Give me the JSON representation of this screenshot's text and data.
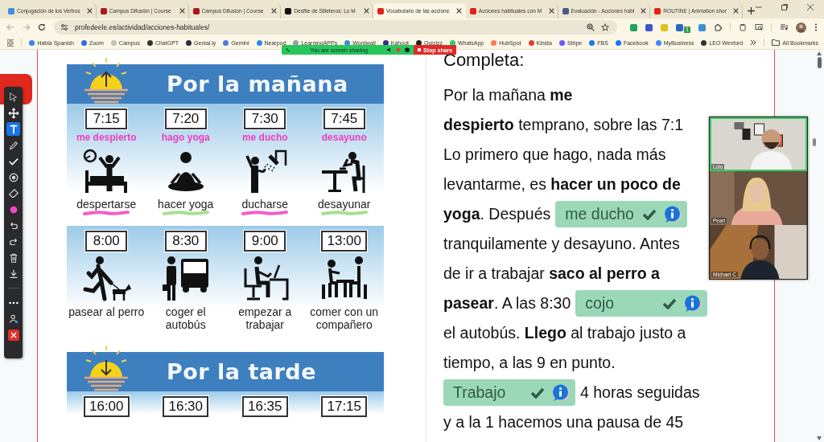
{
  "browser": {
    "tabs": [
      {
        "title": "Conjugación de los Verbos",
        "color": "#3d8fe0",
        "selected": false
      },
      {
        "title": "Campus Difusión | Course",
        "color": "#b01818",
        "selected": false
      },
      {
        "title": "Campus Difusión | Course",
        "color": "#b01818",
        "selected": false
      },
      {
        "title": "Desfile de Silleteros: Lo M",
        "color": "#111111",
        "selected": false
      },
      {
        "title": "Vocabulario de las accione",
        "color": "#e02020",
        "selected": true
      },
      {
        "title": "Acciones habituales con M",
        "color": "#e02020",
        "selected": false
      },
      {
        "title": "Evaluación - Acciones habi",
        "color": "#4a5a8a",
        "selected": false
      },
      {
        "title": "ROUTINE | Animation shor",
        "color": "#e62117",
        "selected": false
      }
    ],
    "address": "profedeele.es/actividad/acciones-habituales/",
    "extensions": [
      {
        "color": "#1fa463"
      },
      {
        "color": "#3a56d4"
      },
      {
        "color": "#e0c020"
      },
      {
        "color": "#2a66c8",
        "badge": "1"
      },
      {
        "color": "#3d8fe0"
      }
    ],
    "bookmarks": [
      {
        "label": "Habla Spanish",
        "color": "#3b82f6"
      },
      {
        "label": "Zoom",
        "color": "#2d6cdf"
      },
      {
        "label": "Campus",
        "color": "#c0c0c0"
      },
      {
        "label": "ChatGPT",
        "color": "#333333"
      },
      {
        "label": "Genial.ly",
        "color": "#2a2a40"
      },
      {
        "label": "Gemini",
        "color": "#4a7be0"
      },
      {
        "label": "Nearpod",
        "color": "#2f8ce0"
      },
      {
        "label": "LearningAPPs",
        "color": "#9aa0a8"
      },
      {
        "label": "Wordwall",
        "color": "#3d8fe0"
      },
      {
        "label": "Kahoot",
        "color": "#3b2a8c"
      },
      {
        "label": "Quizizz",
        "color": "#222222"
      },
      {
        "label": "WhatsApp",
        "color": "#25d366"
      },
      {
        "label": "HubSpot",
        "color": "#ff7a59"
      },
      {
        "label": "Kinsta",
        "color": "#e04040"
      },
      {
        "label": "Stripe",
        "color": "#635bff"
      },
      {
        "label": "FBS",
        "color": "#1877f2"
      },
      {
        "label": "Facebook",
        "color": "#1877f2"
      },
      {
        "label": "MyBusiness",
        "color": "#4285f4"
      },
      {
        "label": "LEO Wexford",
        "color": "#333333"
      }
    ],
    "all_bookmarks": "All Bookmarks"
  },
  "screen_share": {
    "status": "You are screen sharing",
    "stop": "Stop share"
  },
  "annotation_toolbar": {
    "tools": [
      {
        "kind": "pointer",
        "selected": false
      },
      {
        "kind": "move",
        "selected": false
      },
      {
        "kind": "text",
        "selected": true
      },
      {
        "kind": "pen",
        "selected": false
      },
      {
        "kind": "check",
        "selected": false
      },
      {
        "kind": "spotlight",
        "selected": false
      },
      {
        "kind": "eraser",
        "selected": false
      },
      {
        "kind": "color",
        "selected": false
      },
      {
        "kind": "undo",
        "selected": false
      },
      {
        "kind": "redo",
        "selected": false
      },
      {
        "kind": "trash",
        "selected": false
      },
      {
        "kind": "save",
        "selected": false
      },
      {
        "kind": "more",
        "selected": false
      },
      {
        "kind": "participant",
        "selected": false
      },
      {
        "kind": "close",
        "selected": false
      }
    ]
  },
  "worksheet": {
    "sections": [
      {
        "title": "Por la mañana",
        "kind": "rise",
        "rows": [
          [
            {
              "time": "7:15",
              "note": "me despierto",
              "kind": "bed",
              "label": "despertarse",
              "color": "#f060c8"
            },
            {
              "time": "7:20",
              "note": "hago yoga",
              "kind": "yoga",
              "label": "hacer yoga",
              "color": "#a8e090"
            },
            {
              "time": "7:30",
              "note": "me ducho",
              "kind": "shower",
              "label": "ducharse",
              "color": "#f060c8"
            },
            {
              "time": "7:45",
              "note": "desayuno",
              "kind": "breakfast",
              "label": "desayunar",
              "color": "#a8e090"
            }
          ],
          [
            {
              "time": "8:00",
              "kind": "dog",
              "label": "pasear al perro"
            },
            {
              "time": "8:30",
              "kind": "bus",
              "label": "coger el autobús"
            },
            {
              "time": "9:00",
              "kind": "desk",
              "label": "empezar a trabajar"
            },
            {
              "time": "13:00",
              "kind": "lunch",
              "label": "comer con un compañero"
            }
          ]
        ]
      },
      {
        "title": "Por la tarde",
        "kind": "set",
        "rows": [
          [
            {
              "time": "16:00"
            },
            {
              "time": "16:30"
            },
            {
              "time": "16:35"
            },
            {
              "time": "17:15"
            }
          ]
        ]
      }
    ]
  },
  "exercise": {
    "heading": "Completa:",
    "lines": [
      {
        "parts": [
          {
            "kind": "text",
            "text": "Por la mañana **me**"
          }
        ]
      },
      {
        "parts": [
          {
            "kind": "text",
            "text": "**despierto** temprano, sobre las 7:1"
          }
        ]
      },
      {
        "parts": [
          {
            "kind": "text",
            "text": "Lo primero que hago, nada más"
          }
        ]
      },
      {
        "parts": [
          {
            "kind": "text",
            "text": "levantarme, es **hacer un poco de**"
          }
        ]
      },
      {
        "parts": [
          {
            "kind": "text",
            "text": "**yoga**. Después"
          },
          {
            "kind": "answer",
            "value": "me ducho",
            "correct": true
          }
        ]
      },
      {
        "parts": [
          {
            "kind": "text",
            "text": "tranquilamente y desayuno. Antes"
          }
        ]
      },
      {
        "parts": [
          {
            "kind": "text",
            "text": "de ir a trabajar **saco al perro a**"
          }
        ]
      },
      {
        "parts": [
          {
            "kind": "text",
            "text": "**pasear**. A las 8:30"
          },
          {
            "kind": "answer",
            "value": "cojo",
            "correct": true
          }
        ]
      },
      {
        "parts": [
          {
            "kind": "text",
            "text": "el autobús. **Llego** al trabajo justo a"
          }
        ]
      },
      {
        "parts": [
          {
            "kind": "text",
            "text": "tiempo, a las 9 en punto."
          }
        ]
      },
      {
        "parts": [
          {
            "kind": "answer",
            "value": "Trabajo",
            "correct": true
          },
          {
            "kind": "text",
            "text": "4 horas seguidas"
          }
        ]
      },
      {
        "parts": [
          {
            "kind": "text",
            "text": "y a la 1 hacemos una pausa de 45"
          }
        ]
      }
    ]
  },
  "video_call": {
    "participants": [
      {
        "name": "Lolo",
        "speaking": true
      },
      {
        "name": "Pearl",
        "speaking": false
      },
      {
        "name": "Michael C",
        "speaking": false
      }
    ]
  }
}
